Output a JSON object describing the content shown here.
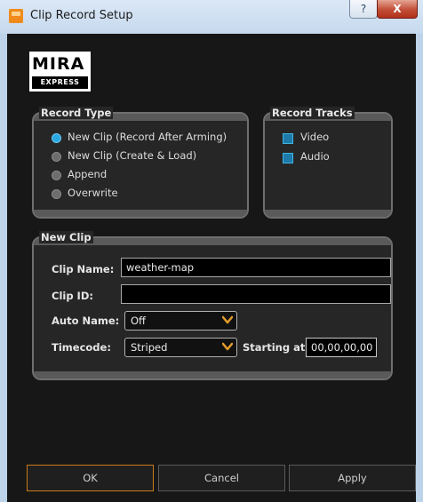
{
  "window": {
    "title": "Clip Record Setup",
    "help_glyph": "?",
    "close_glyph": "X"
  },
  "logo": {
    "top": "MIRA",
    "bottom": "EXPRESS"
  },
  "record_type": {
    "label": "Record Type",
    "options": [
      {
        "label": "New Clip (Record After Arming)",
        "selected": true
      },
      {
        "label": "New Clip (Create & Load)",
        "selected": false
      },
      {
        "label": "Append",
        "selected": false
      },
      {
        "label": "Overwrite",
        "selected": false
      }
    ]
  },
  "record_tracks": {
    "label": "Record Tracks",
    "items": [
      {
        "label": "Video",
        "checked": true
      },
      {
        "label": "Audio",
        "checked": true
      }
    ]
  },
  "new_clip": {
    "label": "New Clip",
    "clip_name_label": "Clip Name:",
    "clip_name_value": "weather-map",
    "clip_id_label": "Clip ID:",
    "clip_id_value": "",
    "auto_name_label": "Auto Name:",
    "auto_name_value": "Off",
    "timecode_label": "Timecode:",
    "timecode_value": "Striped",
    "starting_label": "Starting at:",
    "starting_value": "00,00,00,00"
  },
  "buttons": {
    "ok": "OK",
    "cancel": "Cancel",
    "apply": "Apply"
  },
  "colors": {
    "accent": "#2aa8e0",
    "focus_border": "#c77a19",
    "background": "#171717"
  },
  "icons": {
    "app": "app-icon",
    "help": "help-icon",
    "close": "close-icon",
    "dropdown": "chevron-down-icon"
  }
}
